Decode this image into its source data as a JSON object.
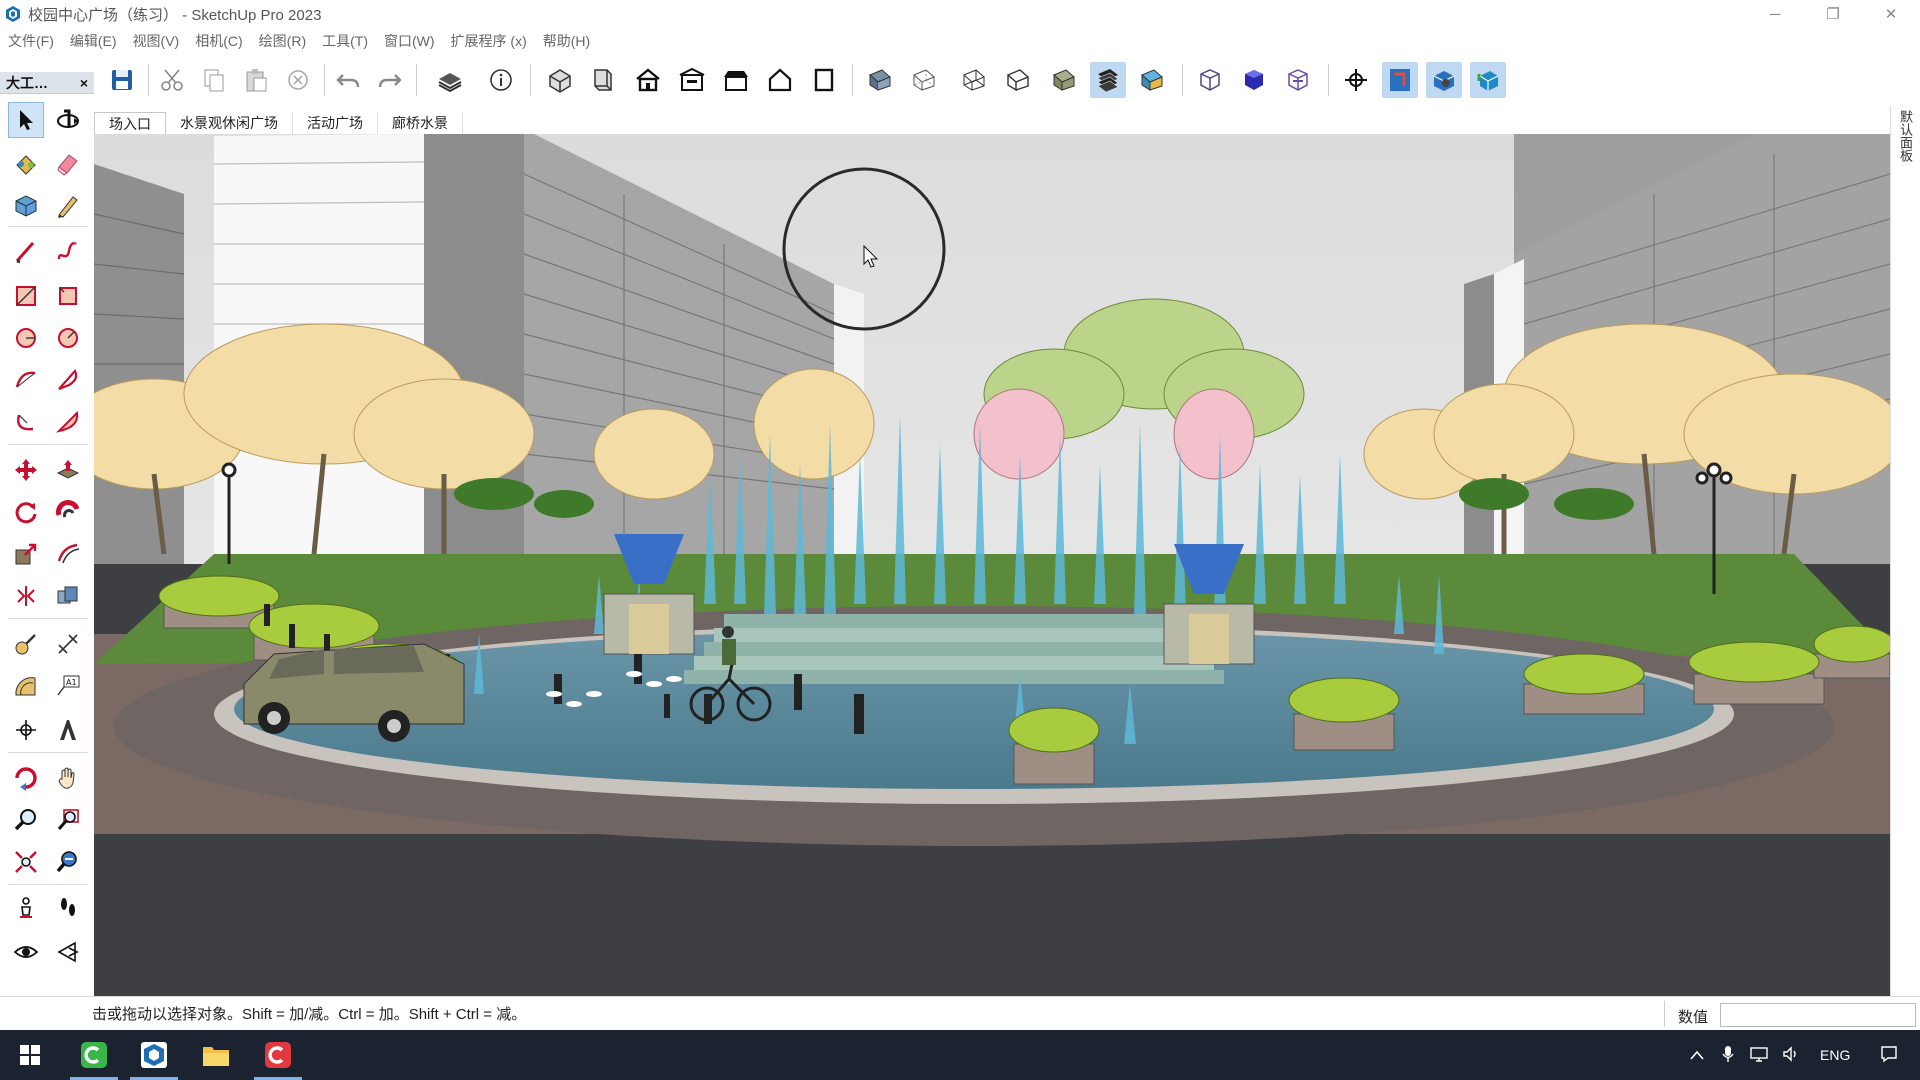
{
  "window": {
    "title": "校园中心广场（练习） - SketchUp Pro 2023",
    "minimize_glyph": "─",
    "restore_glyph": "❐",
    "close_glyph": "✕"
  },
  "menu": [
    "文件(F)",
    "编辑(E)",
    "视图(V)",
    "相机(C)",
    "绘图(R)",
    "工具(T)",
    "窗口(W)",
    "扩展程序 (x)",
    "帮助(H)"
  ],
  "toolbar": {
    "icons": [
      "save-icon",
      "cut-icon",
      "copy-icon",
      "paste-icon",
      "erase-icon",
      "undo-icon",
      "redo-icon",
      "print-icon",
      "model-info-icon",
      "iso-view-icon",
      "top-view-icon",
      "front-view-icon",
      "right-view-icon",
      "back-view-icon",
      "left-view-icon",
      "bottom-view-icon",
      "xray-icon",
      "back-edges-icon",
      "wireframe-icon",
      "hidden-line-icon",
      "shaded-icon",
      "shaded-textures-icon",
      "monochrome-icon",
      "section-plane-icon",
      "display-section-planes-icon",
      "display-section-cuts-icon",
      "axes-icon",
      "position-camera-icon",
      "walk-icon",
      "look-around-icon"
    ]
  },
  "left_panel": {
    "title": "大工…",
    "close_glyph": "×"
  },
  "scene_tabs": [
    "场入口",
    "水景观休闲广场",
    "活动广场",
    "廊桥水景"
  ],
  "right_panel": {
    "label": "默认面板"
  },
  "status": {
    "hint": "击或拖动以选择对象。Shift = 加/减。Ctrl = 加。Shift + Ctrl = 减。",
    "measurements_label": "数值",
    "measurements_value": ""
  },
  "taskbar": {
    "apps": [
      "start-icon",
      "camtasia-icon",
      "sketchup-icon",
      "file-explorer-icon",
      "camtasia-recorder-icon"
    ],
    "lang": "ENG"
  },
  "colors": {
    "accent": "#bfd9f2",
    "sky": "#e4e4e4",
    "road": "#3e3f42",
    "grass": "#5a8a3a",
    "water": "#5fa9c9",
    "taskbar": "#1b2230"
  }
}
